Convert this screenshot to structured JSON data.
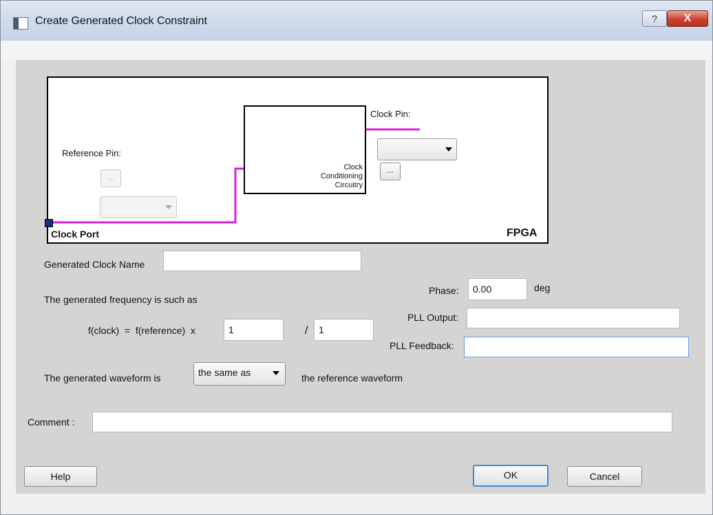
{
  "window": {
    "title": "Create Generated Clock Constraint",
    "help_glyph": "?",
    "close_glyph": "X"
  },
  "diagram": {
    "reference_pin_label": "Reference Pin:",
    "reference_browse_label": "...",
    "reference_pin_value": "",
    "clock_pin_label": "Clock Pin:",
    "clock_pin_value": "",
    "clock_browse_label": "...",
    "ccc_line1": "Clock",
    "ccc_line2": "Conditioning",
    "ccc_line3": "Circuitry",
    "clock_port_label": "Clock Port",
    "fpga_label": "FPGA"
  },
  "form": {
    "generated_clock_name_label": "Generated Clock Name",
    "generated_clock_name_value": "",
    "frequency_text": "The generated frequency is such as",
    "formula_left": "f(clock)  =  f(reference)  x",
    "multiplier_value": "1",
    "divider_symbol": "/",
    "divider_value": "1",
    "phase_label": "Phase:",
    "phase_value": "0.00",
    "phase_unit": "deg",
    "pll_output_label": "PLL Output:",
    "pll_output_value": "",
    "pll_feedback_label": "PLL Feedback:",
    "pll_feedback_value": "",
    "waveform_prefix": "The generated waveform is",
    "waveform_select_value": "the same as",
    "waveform_suffix": "the reference waveform",
    "comment_label": "Comment :",
    "comment_value": ""
  },
  "buttons": {
    "help": "Help",
    "ok": "OK",
    "cancel": "Cancel"
  },
  "colors": {
    "clock_wire": "#d81ed8",
    "signal_path": "#4e7a3e",
    "accent": "#3c8ad8"
  }
}
